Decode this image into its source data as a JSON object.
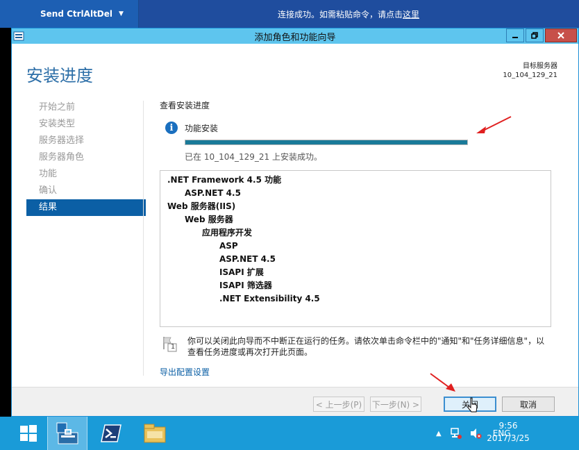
{
  "remote": {
    "button_label": "Send CtrlAltDel",
    "message_prefix": "连接成功。如需粘贴命令，请点击",
    "message_link": "这里"
  },
  "window": {
    "title": "添加角色和功能向导",
    "page_title": "安装进度",
    "target_server_label": "目标服务器",
    "target_server_name": "10_104_129_21"
  },
  "nav": {
    "items": [
      {
        "label": "开始之前",
        "active": false
      },
      {
        "label": "安装类型",
        "active": false
      },
      {
        "label": "服务器选择",
        "active": false
      },
      {
        "label": "服务器角色",
        "active": false
      },
      {
        "label": "功能",
        "active": false
      },
      {
        "label": "确认",
        "active": false
      },
      {
        "label": "结果",
        "active": true
      }
    ]
  },
  "main": {
    "section_header": "查看安装进度",
    "progress_label": "功能安装",
    "progress_percent": 100,
    "success_text": "已在 10_104_129_21 上安装成功。",
    "results": [
      {
        "label": ".NET Framework 4.5 功能",
        "level": 0
      },
      {
        "label": "ASP.NET 4.5",
        "level": 1
      },
      {
        "label": "Web 服务器(IIS)",
        "level": 0
      },
      {
        "label": "Web 服务器",
        "level": 1
      },
      {
        "label": "应用程序开发",
        "level": 2
      },
      {
        "label": "ASP",
        "level": 3
      },
      {
        "label": "ASP.NET 4.5",
        "level": 3
      },
      {
        "label": "ISAPI 扩展",
        "level": 3
      },
      {
        "label": "ISAPI 筛选器",
        "level": 3
      },
      {
        "label": ".NET Extensibility 4.5",
        "level": 3
      }
    ],
    "note_text": "你可以关闭此向导而不中断正在运行的任务。请依次单击命令栏中的\"通知\"和\"任务详细信息\"，以查看任务进度或再次打开此页面。",
    "note_icon_number": "1",
    "export_link": "导出配置设置"
  },
  "footer": {
    "prev": "< 上一步(P)",
    "next": "下一步(N) >",
    "close": "关闭",
    "cancel": "取消"
  },
  "taskbar": {
    "language": "ENG",
    "time": "9:56",
    "date": "2017/3/25"
  },
  "colors": {
    "accent": "#0b5fa5",
    "titlebar": "#5ec5ee",
    "taskbar": "#1a9bd8",
    "progress": "#1a7a99",
    "annotation_arrow": "#e02020"
  }
}
